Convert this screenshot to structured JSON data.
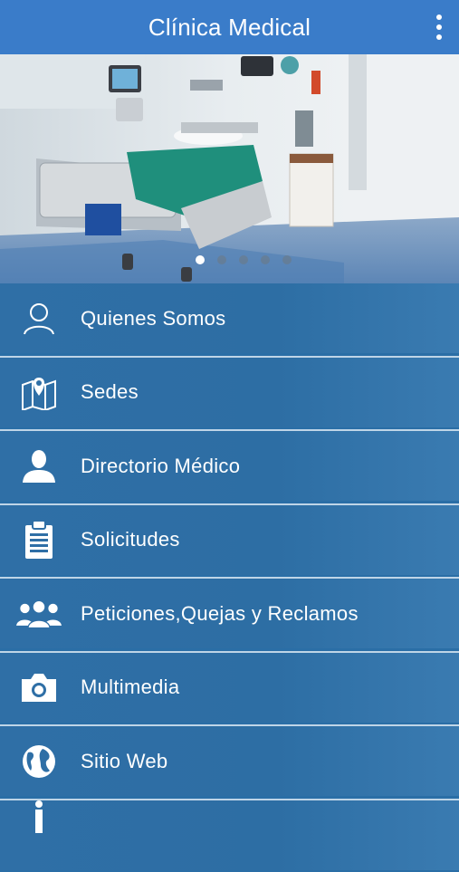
{
  "app_bar": {
    "title": "Clínica Medical",
    "overflow_icon": "more-vert-icon"
  },
  "hero": {
    "slide_count": 5,
    "active_slide": 1
  },
  "menu": {
    "items": [
      {
        "label": "Quienes Somos",
        "icon": "person-outline-icon"
      },
      {
        "label": "Sedes",
        "icon": "map-pin-icon"
      },
      {
        "label": "Directorio Médico",
        "icon": "person-silhouette-icon"
      },
      {
        "label": "Solicitudes",
        "icon": "clipboard-icon"
      },
      {
        "label": "Peticiones,Quejas y Reclamos",
        "icon": "group-icon"
      },
      {
        "label": "Multimedia",
        "icon": "camera-icon"
      },
      {
        "label": "Sitio Web",
        "icon": "globe-icon"
      },
      {
        "label": "",
        "icon": "person-info-icon"
      }
    ]
  },
  "colors": {
    "app_bar": "#3a7cc9",
    "menu_bg": "#2f6fa6",
    "separator": "#cfe0ee",
    "text": "#ffffff"
  }
}
